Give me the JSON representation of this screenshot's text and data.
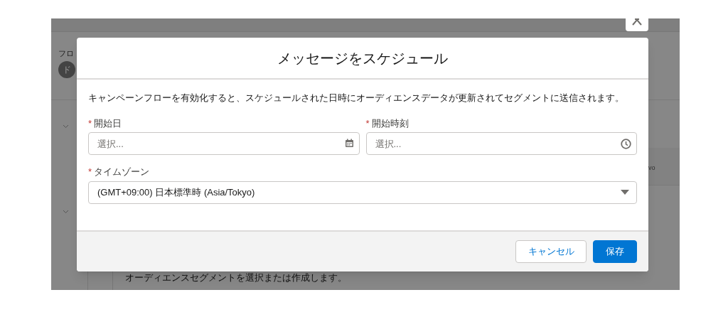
{
  "background": {
    "section_label": "フロ",
    "badge": "ド",
    "segment_hint": "オーディエンスセグメントを選択または作成します。",
    "side_text": "vo"
  },
  "dialog": {
    "title": "メッセージをスケジュール",
    "description": "キャンペーンフローを有効化すると、スケジュールされた日時にオーディエンスデータが更新されてセグメントに送信されます。",
    "fields": [
      {
        "kind": "date",
        "label": "開始日",
        "required_mark": "*",
        "placeholder": "選択..."
      },
      {
        "kind": "time",
        "label": "開始時刻",
        "required_mark": "*",
        "placeholder": "選択..."
      },
      {
        "kind": "select",
        "label": "タイムゾーン",
        "required_mark": "*",
        "value": "(GMT+09:00) 日本標準時 (Asia/Tokyo)"
      }
    ],
    "buttons": [
      {
        "label": "キャンセル",
        "kind": "neutral"
      },
      {
        "label": "保存",
        "kind": "brand"
      }
    ]
  }
}
